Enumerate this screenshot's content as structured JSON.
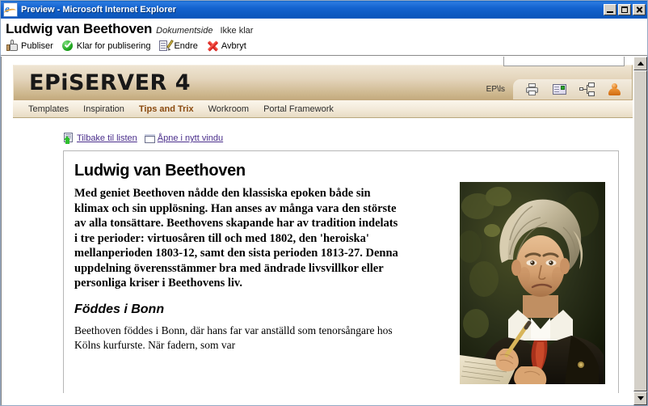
{
  "window": {
    "title": "Preview - Microsoft Internet Explorer",
    "icon": "internet-explorer-icon",
    "controls": {
      "minimize": "Minimize",
      "maximize": "Maximize",
      "close": "Close"
    }
  },
  "document_header": {
    "title": "Ludwig van Beethoven",
    "type": "Dokumentside",
    "status": "Ikke klar"
  },
  "toolbar": {
    "items": [
      {
        "label": "Publiser",
        "icon": "thumbs-up-icon"
      },
      {
        "label": "Klar for publisering",
        "icon": "green-check-icon"
      },
      {
        "label": "Endre",
        "icon": "edit-pencil-icon"
      },
      {
        "label": "Avbryt",
        "icon": "red-x-icon"
      }
    ]
  },
  "site": {
    "logo": "EPiSERVER 4",
    "search": {
      "value": "",
      "placeholder": ""
    },
    "user_label": "EP\\ls",
    "header_icons": [
      {
        "name": "printer-icon"
      },
      {
        "name": "email-icon"
      },
      {
        "name": "sitemap-icon"
      },
      {
        "name": "user-icon"
      }
    ],
    "nav": [
      {
        "label": "Templates",
        "active": false
      },
      {
        "label": "Inspiration",
        "active": false
      },
      {
        "label": "Tips and Trix",
        "active": true
      },
      {
        "label": "Workroom",
        "active": false
      },
      {
        "label": "Portal Framework",
        "active": false
      }
    ]
  },
  "content": {
    "links": [
      {
        "label": "Tilbake til listen",
        "icon": "back-to-list-icon"
      },
      {
        "label": "Åpne i nytt vindu",
        "icon": "new-window-icon"
      }
    ],
    "article": {
      "title": "Ludwig van Beethoven",
      "lead": "Med geniet Beethoven nådde den klassiska epoken både sin klimax och sin upplösning. Han anses av många vara den störste av alla tonsättare. Beethovens skapande har av tradition indelats i tre perioder: virtuosåren till och med 1802, den 'heroiska' mellanperioden 1803-12, samt den sista perioden 1813-27. Denna uppdelning överensstämmer bra med ändrade livsvillkor eller personliga kriser i Beethovens liv.",
      "subheading": "Föddes i Bonn",
      "body": "Beethoven föddes i Bonn, där hans far var anställd som tenorsångare hos Kölns kurfurste. När fadern, som var",
      "image_alt": "Portrait of Ludwig van Beethoven"
    }
  },
  "colors": {
    "titlebar_blue": "#1463cf",
    "header_tan": "#d9c9a6",
    "active_nav": "#8a4a10",
    "link_purple": "#4b2f8c"
  }
}
